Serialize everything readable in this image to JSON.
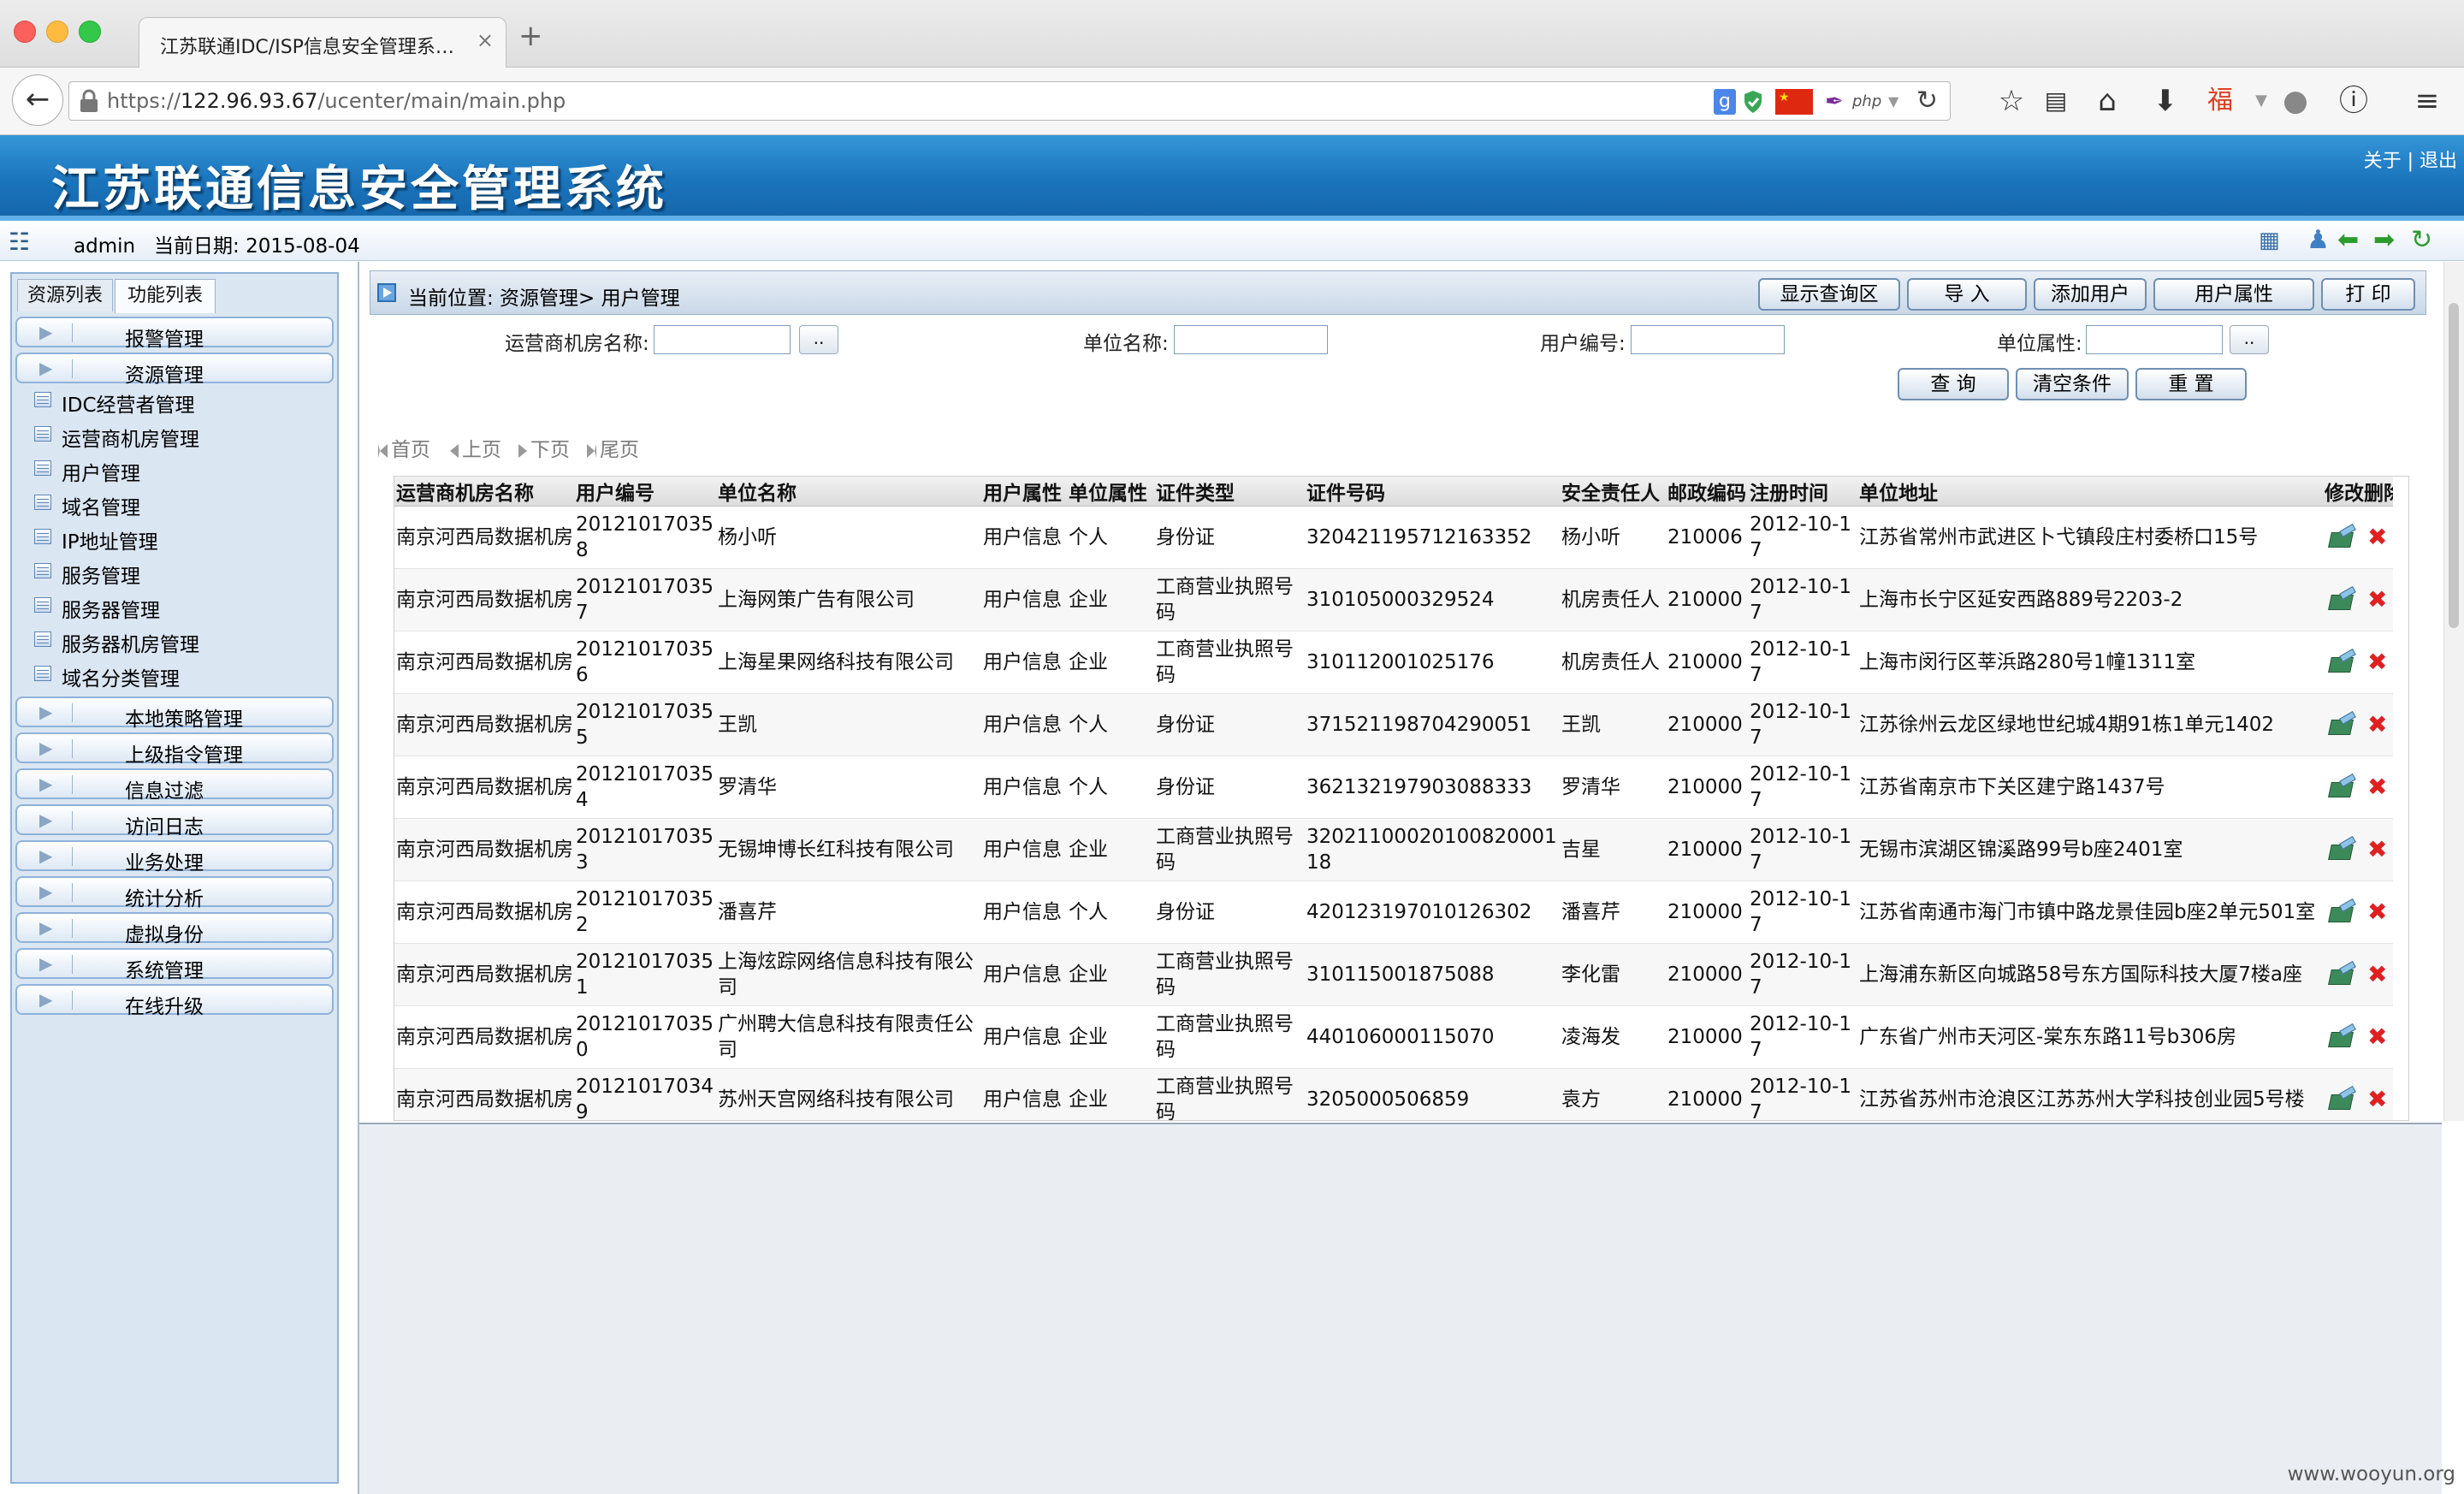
{
  "browser": {
    "tab_title": "江苏联通IDC/ISP信息安全管理系…",
    "tab_close": "×",
    "new_tab": "+",
    "url_scheme": "https://",
    "url_host": "122.96.93.67",
    "url_path": "/ucenter/main/main.php",
    "addon_php": "php"
  },
  "header": {
    "title": "江苏联通信息安全管理系统",
    "links": "关于 | 退出"
  },
  "userbar": {
    "user": "admin",
    "date_label": "当前日期:",
    "date": "2015-08-04"
  },
  "sidebar": {
    "tabs": [
      "资源列表",
      "功能列表"
    ],
    "groups_top": [
      "报警管理",
      "资源管理"
    ],
    "resource_items": [
      "IDC经营者管理",
      "运营商机房管理",
      "用户管理",
      "域名管理",
      "IP地址管理",
      "服务管理",
      "服务器管理",
      "服务器机房管理",
      "域名分类管理"
    ],
    "groups_bottom": [
      "本地策略管理",
      "上级指令管理",
      "信息过滤",
      "访问日志",
      "业务处理",
      "统计分析",
      "虚拟身份",
      "系统管理",
      "在线升级"
    ]
  },
  "main": {
    "breadcrumb": "当前位置:  资源管理> 用户管理",
    "toolbar": [
      "显示查询区",
      "导  入",
      "添加用户",
      "用户属性",
      "打  印"
    ],
    "filters": {
      "room_label": "运营商机房名称:",
      "unit_label": "单位名称:",
      "userno_label": "用户编号:",
      "attr_label": "单位属性:",
      "dots": ".."
    },
    "query_buttons": [
      "查  询",
      "清空条件",
      "重  置"
    ],
    "pager": [
      "首页",
      "上页",
      "下页",
      "尾页"
    ]
  },
  "table": {
    "headers": [
      "运营商机房名称",
      "用户编号",
      "单位名称",
      "用户属性",
      "单位属性",
      "证件类型",
      "证件号码",
      "安全责任人",
      "邮政编码",
      "注册时间",
      "单位地址",
      "修改删除"
    ],
    "rows": [
      [
        "南京河西局数据机房",
        "201210170358",
        "杨小听",
        "用户信息",
        "个人",
        "身份证",
        "320421195712163352",
        "杨小听",
        "210006",
        "2012-10-17",
        "江苏省常州市武进区卜弋镇段庄村委桥口15号"
      ],
      [
        "南京河西局数据机房",
        "201210170357",
        "上海网策广告有限公司",
        "用户信息",
        "企业",
        "工商营业执照号码",
        "310105000329524",
        "机房责任人",
        "210000",
        "2012-10-17",
        "上海市长宁区延安西路889号2203-2"
      ],
      [
        "南京河西局数据机房",
        "201210170356",
        "上海星果网络科技有限公司",
        "用户信息",
        "企业",
        "工商营业执照号码",
        "310112001025176",
        "机房责任人",
        "210000",
        "2012-10-17",
        "上海市闵行区莘浜路280号1幢1311室"
      ],
      [
        "南京河西局数据机房",
        "201210170355",
        "王凯",
        "用户信息",
        "个人",
        "身份证",
        "371521198704290051",
        "王凯",
        "210000",
        "2012-10-17",
        "江苏徐州云龙区绿地世纪城4期91栋1单元1402"
      ],
      [
        "南京河西局数据机房",
        "201210170354",
        "罗清华",
        "用户信息",
        "个人",
        "身份证",
        "362132197903088333",
        "罗清华",
        "210000",
        "2012-10-17",
        "江苏省南京市下关区建宁路1437号"
      ],
      [
        "南京河西局数据机房",
        "201210170353",
        "无锡坤博长红科技有限公司",
        "用户信息",
        "企业",
        "工商营业执照号码",
        "3202110002010082000118",
        "吉星",
        "210000",
        "2012-10-17",
        "无锡市滨湖区锦溪路99号b座2401室"
      ],
      [
        "南京河西局数据机房",
        "201210170352",
        "潘喜芹",
        "用户信息",
        "个人",
        "身份证",
        "420123197010126302",
        "潘喜芹",
        "210000",
        "2012-10-17",
        "江苏省南通市海门市镇中路龙景佳园b座2单元501室"
      ],
      [
        "南京河西局数据机房",
        "201210170351",
        "上海炫踪网络信息科技有限公司",
        "用户信息",
        "企业",
        "工商营业执照号码",
        "310115001875088",
        "李化雷",
        "210000",
        "2012-10-17",
        "上海浦东新区向城路58号东方国际科技大厦7楼a座"
      ],
      [
        "南京河西局数据机房",
        "201210170350",
        "广州聘大信息科技有限责任公司",
        "用户信息",
        "企业",
        "工商营业执照号码",
        "440106000115070",
        "凌海发",
        "210000",
        "2012-10-17",
        "广东省广州市天河区-棠东东路11号b306房"
      ],
      [
        "南京河西局数据机房",
        "201210170349",
        "苏州天宫网络科技有限公司",
        "用户信息",
        "企业",
        "工商营业执照号码",
        "3205000506859",
        "袁方",
        "210000",
        "2012-10-17",
        "江苏省苏州市沧浪区江苏苏州大学科技创业园5号楼"
      ]
    ]
  },
  "watermark": "www.wooyun.org"
}
